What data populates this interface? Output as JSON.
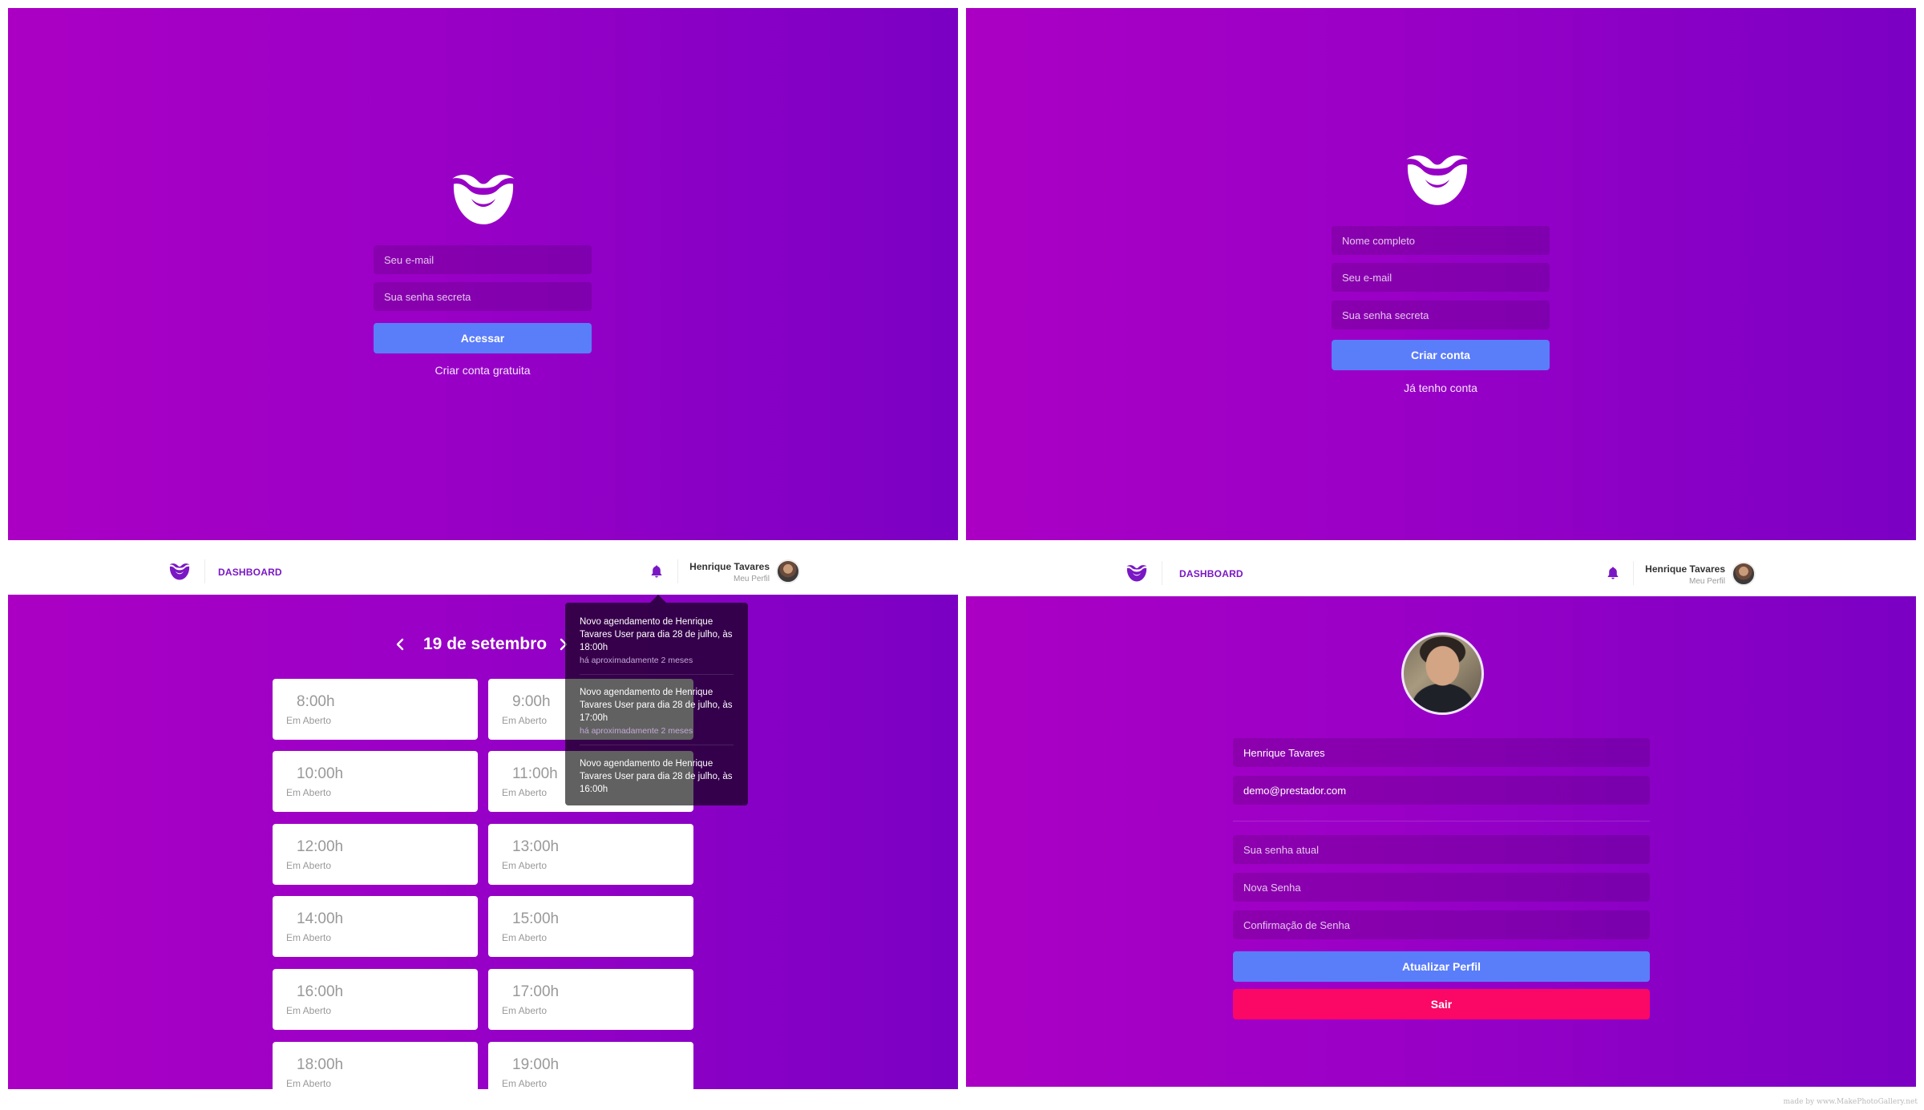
{
  "login": {
    "email_placeholder": "Seu e-mail",
    "password_placeholder": "Sua senha secreta",
    "submit_label": "Acessar",
    "create_account_link": "Criar conta gratuita"
  },
  "signup": {
    "name_placeholder": "Nome completo",
    "email_placeholder": "Seu e-mail",
    "password_placeholder": "Sua senha secreta",
    "submit_label": "Criar conta",
    "login_link": "Já tenho conta"
  },
  "header": {
    "nav_label": "DASHBOARD",
    "user_name": "Henrique Tavares",
    "user_subtitle": "Meu Perfil"
  },
  "dashboard": {
    "date": "19 de setembro",
    "slots": [
      {
        "time": "8:00h",
        "status": "Em Aberto"
      },
      {
        "time": "9:00h",
        "status": "Em Aberto"
      },
      {
        "time": "10:00h",
        "status": "Em Aberto"
      },
      {
        "time": "11:00h",
        "status": "Em Aberto"
      },
      {
        "time": "12:00h",
        "status": "Em Aberto"
      },
      {
        "time": "13:00h",
        "status": "Em Aberto"
      },
      {
        "time": "14:00h",
        "status": "Em Aberto"
      },
      {
        "time": "15:00h",
        "status": "Em Aberto"
      },
      {
        "time": "16:00h",
        "status": "Em Aberto"
      },
      {
        "time": "17:00h",
        "status": "Em Aberto"
      },
      {
        "time": "18:00h",
        "status": "Em Aberto"
      },
      {
        "time": "19:00h",
        "status": "Em Aberto"
      }
    ],
    "notifications": [
      {
        "message": "Novo agendamento de Henrique Tavares User para dia 28 de julho, às 18:00h",
        "time": "há aproximadamente 2 meses"
      },
      {
        "message": "Novo agendamento de Henrique Tavares User para dia 28 de julho, às 17:00h",
        "time": "há aproximadamente 2 meses"
      },
      {
        "message": "Novo agendamento de Henrique Tavares User para dia 28 de julho, às 16:00h",
        "time": ""
      }
    ]
  },
  "profile": {
    "name_value": "Henrique Tavares",
    "email_value": "demo@prestador.com",
    "old_password_placeholder": "Sua senha atual",
    "new_password_placeholder": "Nova Senha",
    "confirm_password_placeholder": "Confirmação de Senha",
    "update_label": "Atualizar Perfil",
    "logout_label": "Sair"
  },
  "colors": {
    "gradient_start": "#ab00c4",
    "gradient_end": "#7b00c4",
    "primary_button": "#5a7df9",
    "danger_button": "#fb0766",
    "nav_accent": "#7a17c4"
  },
  "icons": {
    "logo": "mustache-logo-icon",
    "bell": "bell-icon",
    "prev": "chevron-left-icon",
    "next": "chevron-right-icon"
  },
  "watermark": "made by www.MakePhotoGallery.net"
}
